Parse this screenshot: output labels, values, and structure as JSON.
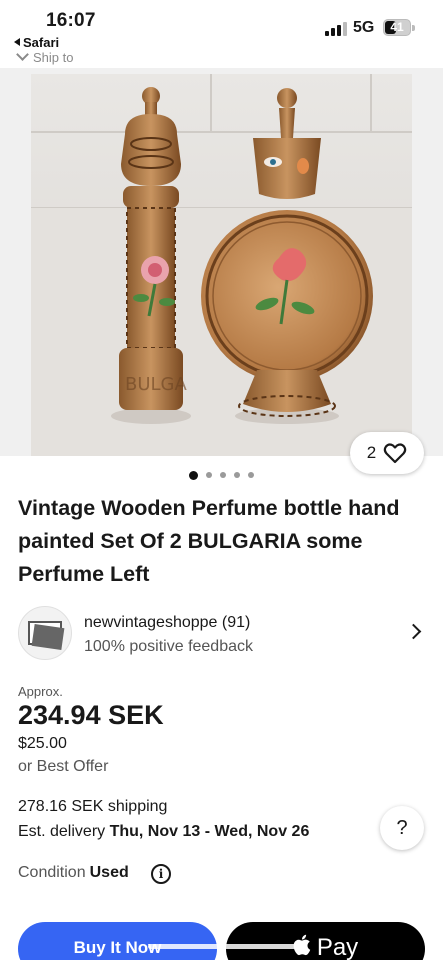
{
  "status_bar": {
    "time": "16:07",
    "back_app": "Safari",
    "network": "5G",
    "battery_level": "41"
  },
  "header": {
    "ship_to": "Ship to"
  },
  "gallery": {
    "watch_count": "2",
    "image_count": 5,
    "active_index": 0
  },
  "listing": {
    "title": "Vintage Wooden Perfume bottle hand painted Set Of 2 BULGARIA some Perfume Left"
  },
  "seller": {
    "name": "newvintageshoppe (91)",
    "feedback": "100% positive feedback"
  },
  "price": {
    "approx_label": "Approx.",
    "converted": "234.94 SEK",
    "original": "$25.00",
    "best_offer": "or Best Offer"
  },
  "shipping": {
    "cost": "278.16 SEK shipping",
    "delivery_prefix": "Est. delivery ",
    "delivery_dates": "Thu, Nov 13 - Wed, Nov 26"
  },
  "condition": {
    "label": "Condition",
    "value": "Used"
  },
  "actions": {
    "buy_now": "Buy It Now",
    "pay": "Pay",
    "help": "?"
  },
  "colors": {
    "accent": "#3665f3",
    "text": "#191919"
  }
}
